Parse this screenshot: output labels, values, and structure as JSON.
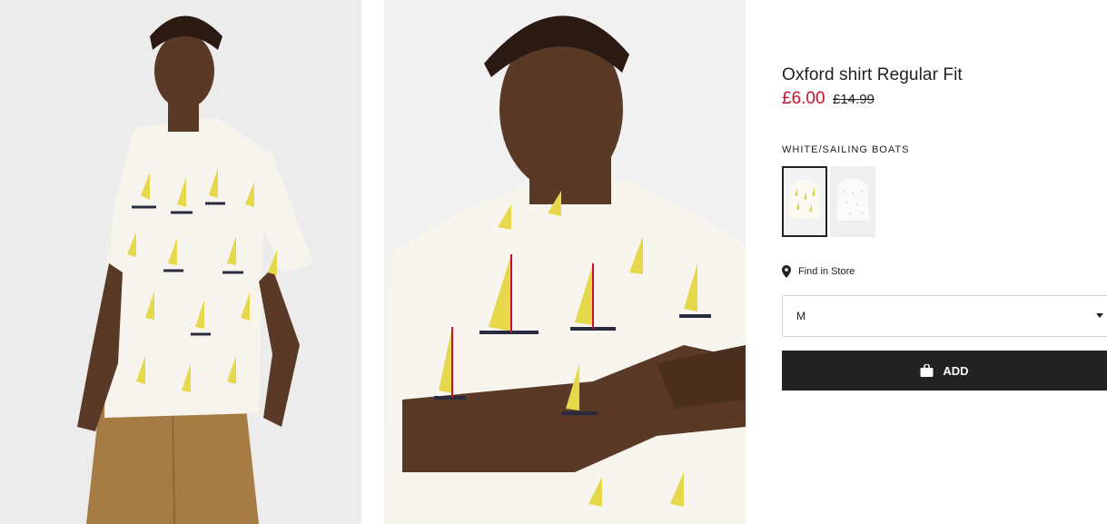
{
  "product": {
    "title": "Oxford shirt Regular Fit",
    "price_sale": "£6.00",
    "price_original": "£14.99",
    "sale_color": "#c8102e"
  },
  "color": {
    "selected_name": "WHITE/SAILING BOATS",
    "swatches": [
      {
        "name": "white-sailing-boats-swatch",
        "selected": true
      },
      {
        "name": "white-swatch",
        "selected": false
      }
    ]
  },
  "store": {
    "label": "Find in Store",
    "icon": "location-pin-icon"
  },
  "size": {
    "selected": "M",
    "icon": "caret-down-icon"
  },
  "add_button": {
    "label": "ADD",
    "icon": "shopping-bag-icon",
    "color": "#222222"
  }
}
